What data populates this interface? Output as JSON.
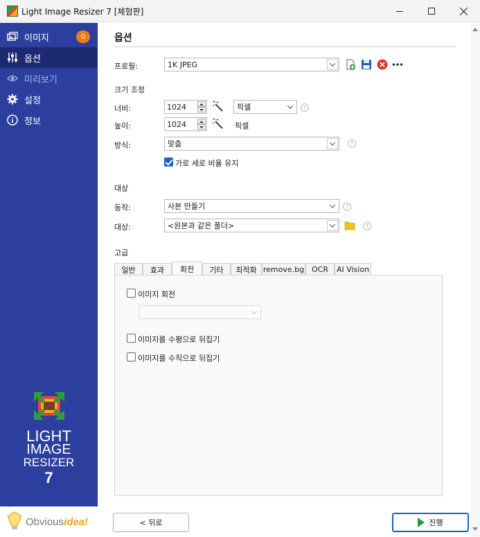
{
  "window": {
    "title": "Light Image Resizer 7  [체험판]"
  },
  "sidebar": {
    "items": [
      {
        "label": "이미지",
        "icon": "images-icon",
        "badge": "0"
      },
      {
        "label": "옵션",
        "icon": "sliders-icon"
      },
      {
        "label": "미리보기",
        "icon": "eye-icon"
      },
      {
        "label": "설정",
        "icon": "gear-icon"
      },
      {
        "label": "정보",
        "icon": "info-icon"
      }
    ],
    "logo": {
      "line1": "LIGHT",
      "line2": "IMAGE",
      "line3": "RESIZER",
      "line4": "7"
    },
    "brand": {
      "part1": "Obvious",
      "part2": "idea!"
    }
  },
  "main": {
    "heading": "옵션",
    "profile": {
      "label": "프로필:",
      "value": "1K JPEG"
    },
    "resize": {
      "section": "크기 조정",
      "width_label": "너비:",
      "width_value": "1024",
      "width_unit": "픽셀",
      "height_label": "높이:",
      "height_value": "1024",
      "height_unit": "픽셀",
      "mode_label": "방식:",
      "mode_value": "맞춤",
      "keep_ratio_label": "가로 세로 비율 유지",
      "keep_ratio_checked": true
    },
    "target": {
      "section": "대상",
      "action_label": "동작:",
      "action_value": "사본 만들기",
      "dest_label": "대상:",
      "dest_value": "<원본과 같은 폴더>"
    },
    "advanced": {
      "section": "고급",
      "tabs": [
        "일반",
        "효과",
        "회전",
        "기타",
        "최적화",
        "remove.bg",
        "OCR",
        "AI Vision"
      ],
      "active_tab": "회전",
      "rotate_label": "이미지 회전",
      "flip_h_label": "이미지를 수평으로 뒤집기",
      "flip_v_label": "이미지를 수직으로 뒤집기"
    }
  },
  "footer": {
    "back_label": "< 뒤로",
    "go_label": "진행"
  },
  "colors": {
    "sidebar": "#2d3f9e",
    "sidebar_active": "#1e2a6f",
    "badge": "#f07a1d",
    "accent": "#1565c0",
    "go": "#1aa33a"
  }
}
